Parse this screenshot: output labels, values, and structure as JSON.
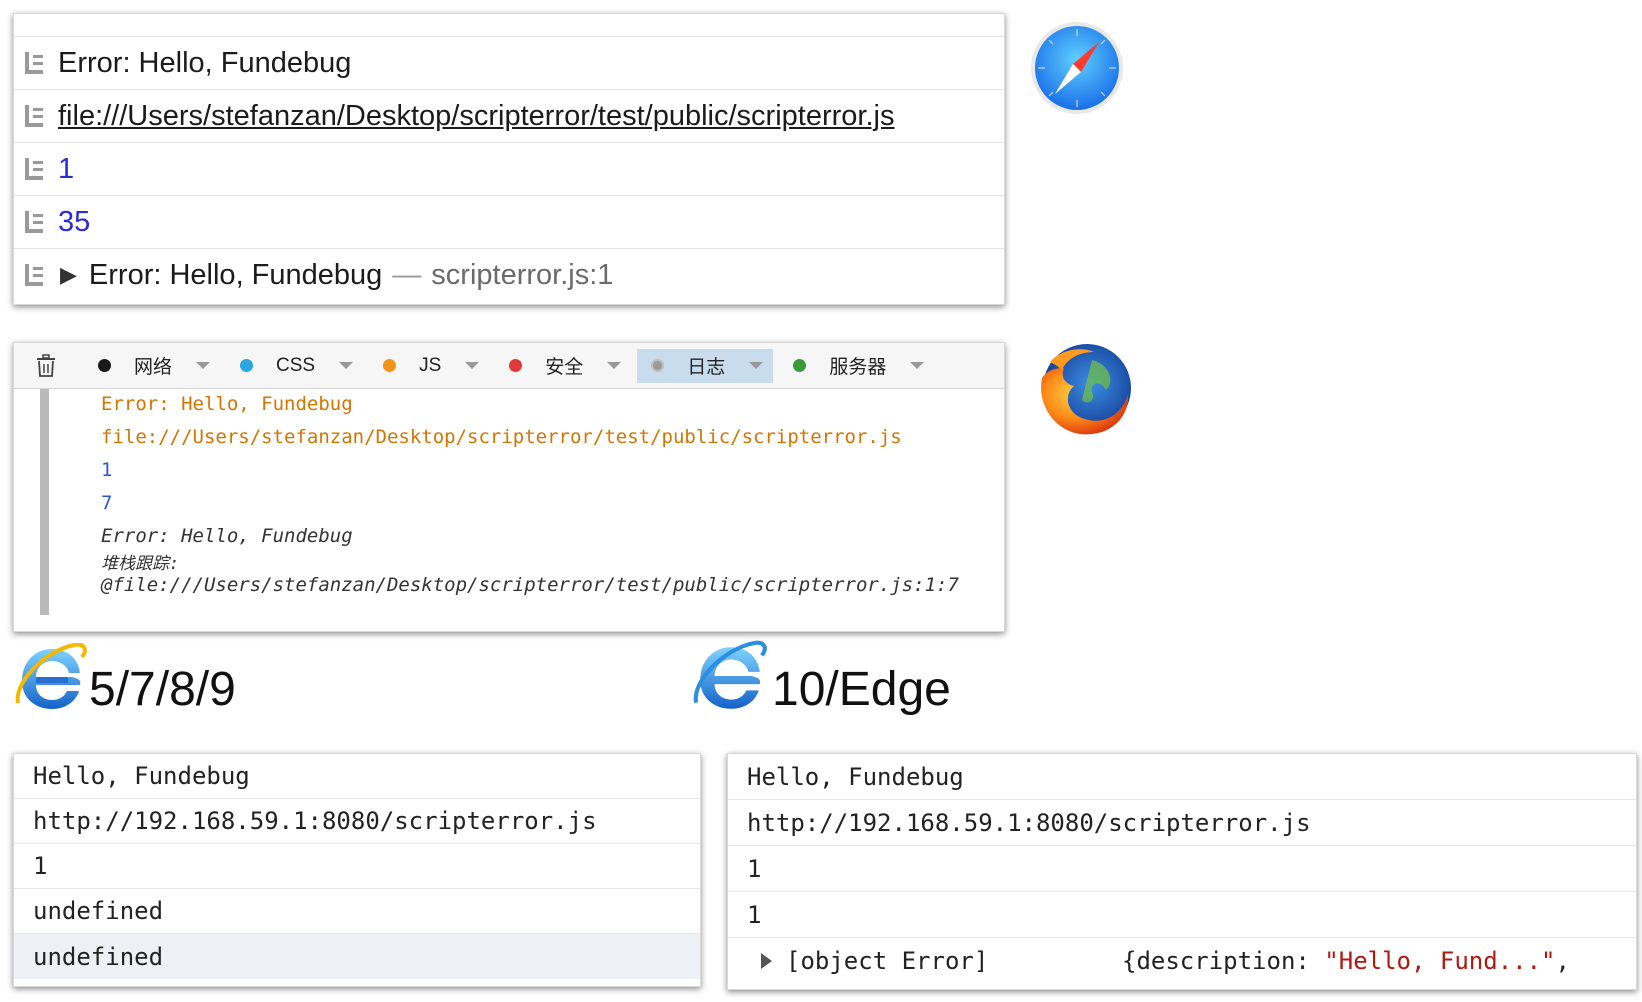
{
  "safari": {
    "rows": [
      {
        "type": "text",
        "text": "Error: Hello, Fundebug"
      },
      {
        "type": "link",
        "text": "file:///Users/stefanzan/Desktop/scripterror/test/public/scripterror.js"
      },
      {
        "type": "number",
        "text": "1"
      },
      {
        "type": "number",
        "text": "35"
      },
      {
        "type": "expandable",
        "text": "Error: Hello, Fundebug",
        "separator": "—",
        "source": "scripterror.js:1"
      }
    ]
  },
  "firefox": {
    "filters": [
      {
        "label": "网络",
        "color": "#1a1a1a"
      },
      {
        "label": "CSS",
        "color": "#2aa6e0"
      },
      {
        "label": "JS",
        "color": "#f29418"
      },
      {
        "label": "安全",
        "color": "#e03a3a"
      },
      {
        "label": "日志",
        "color": "#9a9a9a",
        "active": true
      },
      {
        "label": "服务器",
        "color": "#3a9a3a"
      }
    ],
    "lines": [
      "Error: Hello, Fundebug",
      "file:///Users/stefanzan/Desktop/scripterror/test/public/scripterror.js",
      "1",
      "7",
      "Error: Hello, Fundebug",
      "堆栈跟踪:",
      "@file:///Users/stefanzan/Desktop/scripterror/test/public/scripterror.js:1:7"
    ]
  },
  "ie_old": {
    "label": "5/7/8/9",
    "rows": [
      "Hello, Fundebug",
      "http://192.168.59.1:8080/scripterror.js",
      "1",
      "undefined",
      "undefined"
    ]
  },
  "ie_new": {
    "label": "10/Edge",
    "rows": [
      "Hello, Fundebug",
      "http://192.168.59.1:8080/scripterror.js",
      "1",
      "1"
    ],
    "expandable": {
      "text": "[object Error]",
      "detail_key": "{description: ",
      "detail_value": "\"Hello, Fund...\"",
      "detail_tail": ","
    }
  },
  "icons": [
    "safari-logo-icon",
    "firefox-logo-icon",
    "ie-logo-icon",
    "log-entry-icon",
    "trash-icon",
    "expand-triangle-icon"
  ]
}
